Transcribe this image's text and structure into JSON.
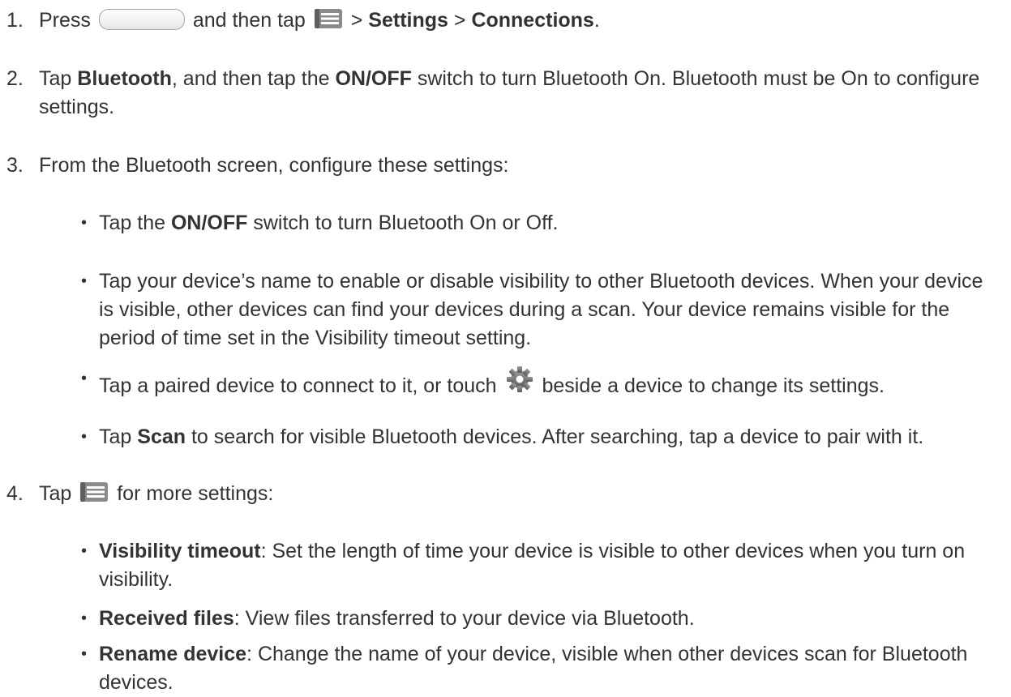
{
  "steps": [
    {
      "number": "1.",
      "press": "Press",
      "then_tap": "and then tap",
      "sep1": ">",
      "settings": "Settings",
      "sep2": ">",
      "connections": "Connections",
      "end": "."
    },
    {
      "number": "2.",
      "tap": "Tap",
      "bluetooth": "Bluetooth",
      "mid": ", and then tap the",
      "onoff": "ON/OFF",
      "rest": "switch to turn Bluetooth On. Bluetooth must be On to configure settings."
    },
    {
      "number": "3.",
      "text": "From the Bluetooth screen, configure these settings:",
      "bullets": [
        {
          "pre": "Tap the",
          "bold": "ON/OFF",
          "rest": "switch to turn Bluetooth On or Off."
        },
        {
          "text": "Tap your device’s name to enable or disable visibility to other Bluetooth devices. When your device is visible, other devices can find your devices during a scan. Your device remains visible for the period of time set in the Visibility timeout setting."
        },
        {
          "pre": "Tap a paired device to connect to it, or touch",
          "rest": "beside a device to change its settings."
        },
        {
          "pre": "Tap",
          "bold": "Scan",
          "rest": "to search for visible Bluetooth devices. After searching, tap a device to pair with it."
        }
      ]
    },
    {
      "number": "4.",
      "tap": "Tap",
      "rest": "for more settings:",
      "bullets": [
        {
          "bold": "Visibility timeout",
          "rest": ": Set the length of time your device is visible to other devices when you turn on visibility."
        },
        {
          "bold": "Received files",
          "rest": ": View files transferred to your device via Bluetooth."
        },
        {
          "bold": "Rename device",
          "rest": ": Change the name of your device, visible when other devices scan for Bluetooth devices."
        }
      ]
    }
  ],
  "bullet_char": "•",
  "icons": {
    "home": "home-button-icon",
    "menu": "menu-key-icon",
    "gear": "gear-icon"
  }
}
